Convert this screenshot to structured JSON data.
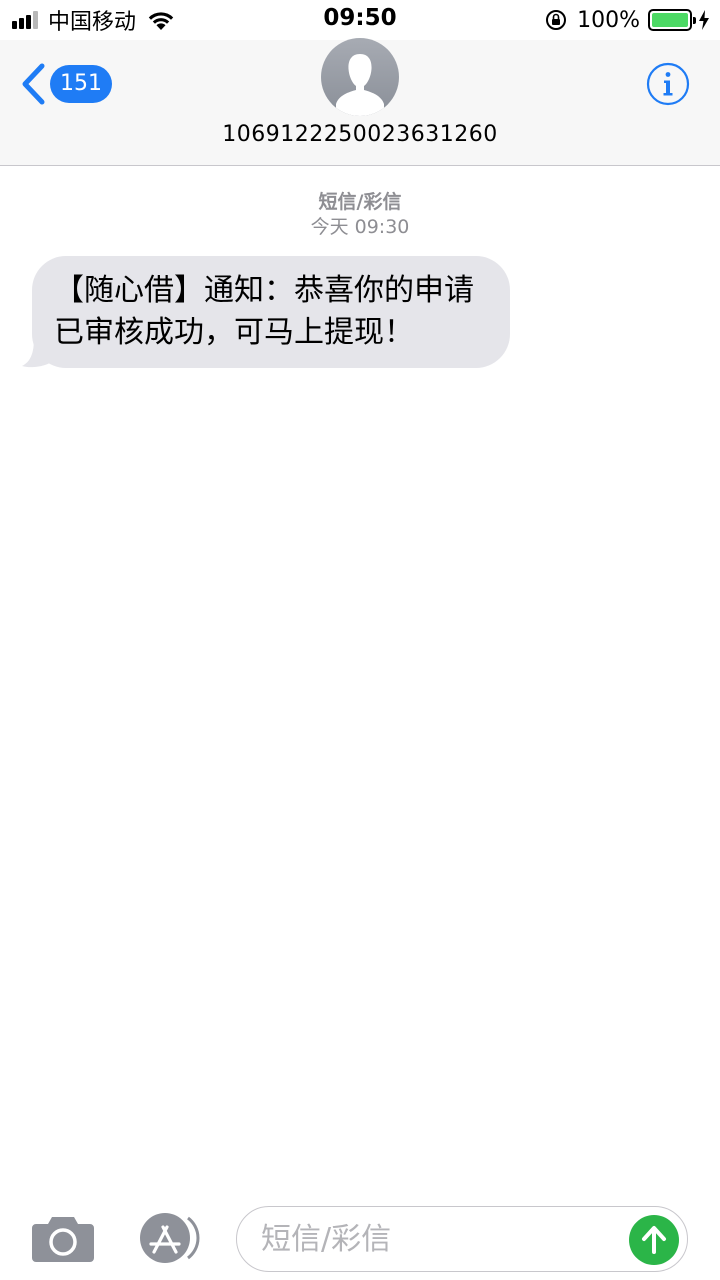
{
  "status_bar": {
    "carrier": "中国移动",
    "time": "09:50",
    "battery_percent": "100%",
    "battery_level": 1.0,
    "signal_bars": 4,
    "signal_bars_active": 3,
    "icons": [
      "signal-icon",
      "wifi-icon",
      "orientation-lock-icon",
      "battery-icon",
      "charging-bolt-icon"
    ]
  },
  "header": {
    "back_badge": "151",
    "contact_number": "1069122250023631260",
    "icons": [
      "chevron-left-icon",
      "avatar-icon",
      "info-icon"
    ]
  },
  "conversation": {
    "message_type": "短信/彩信",
    "timestamp": "今天 09:30",
    "messages": [
      {
        "direction": "incoming",
        "text": "【随心借】通知：恭喜你的申请已审核成功，可马上提现！"
      }
    ]
  },
  "input_bar": {
    "placeholder": "短信/彩信",
    "value": "",
    "icons": [
      "camera-icon",
      "app-store-icon",
      "send-arrow-icon"
    ]
  },
  "colors": {
    "accent_blue": "#1f7cf5",
    "incoming_bubble": "#e5e5ea",
    "send_green": "#2bb548",
    "battery_green": "#4cd964",
    "meta_gray": "#8e8e93"
  }
}
